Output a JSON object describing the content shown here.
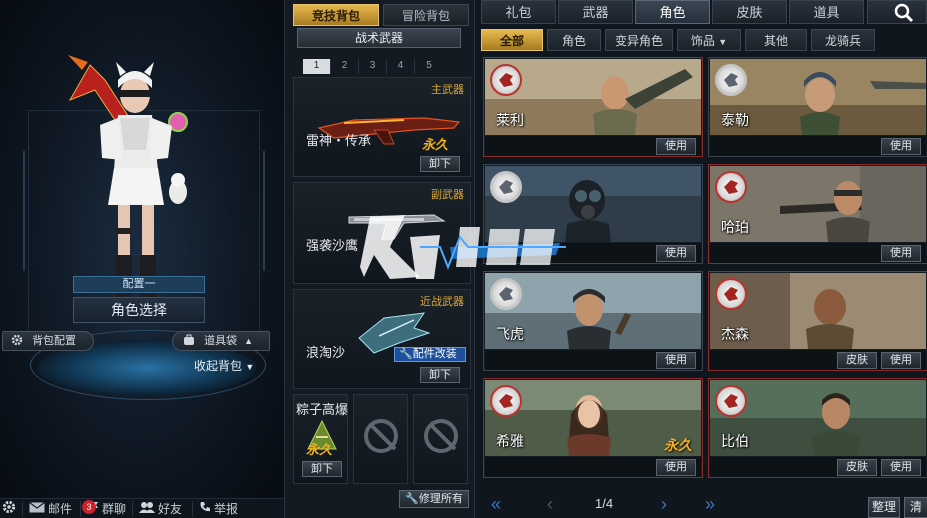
{
  "left": {
    "preset_label": "配置一",
    "char_select_label": "角色选择",
    "bag_config_label": "背包配置",
    "item_bag_label": "道具袋",
    "collapse_bag_label": "收起背包",
    "bottom_bar": {
      "mail_label": "邮件",
      "mail_count": "3",
      "group_chat_label": "群聊",
      "friends_label": "好友",
      "report_label": "举报"
    }
  },
  "middle": {
    "tabs": [
      {
        "label": "竞技背包",
        "active": true
      },
      {
        "label": "冒险背包",
        "active": false
      }
    ],
    "tactical_weapon_label": "战术武器",
    "slot_pages": [
      "1",
      "2",
      "3",
      "4",
      "5"
    ],
    "primary": {
      "category": "主武器",
      "name": "雷神・传承",
      "permanent": "永久",
      "unequip": "卸下"
    },
    "secondary": {
      "category": "副武器",
      "name": "强袭沙鹰"
    },
    "melee": {
      "category": "近战武器",
      "name": "浪淘沙",
      "mod_label": "配件改装",
      "unequip": "卸下"
    },
    "grenade": {
      "name": "粽子高爆",
      "permanent": "永久",
      "unequip": "卸下"
    },
    "repair_all_label": "修理所有"
  },
  "right": {
    "top_tabs": [
      {
        "label": "礼包",
        "active": false
      },
      {
        "label": "武器",
        "active": false
      },
      {
        "label": "角色",
        "active": true
      },
      {
        "label": "皮肤",
        "active": false
      },
      {
        "label": "道具",
        "active": false
      }
    ],
    "filters": [
      {
        "label": "全部",
        "active": true
      },
      {
        "label": "角色",
        "active": false
      },
      {
        "label": "变异角色",
        "active": false
      },
      {
        "label": "饰品",
        "active": false,
        "dropdown": true
      },
      {
        "label": "其他",
        "active": false
      },
      {
        "label": "龙骑兵",
        "active": false
      }
    ],
    "cards": [
      {
        "name": "莱利",
        "theme": "red",
        "buttons": [
          "使用"
        ]
      },
      {
        "name": "泰勒",
        "theme": "gray",
        "buttons": [
          "使用"
        ]
      },
      {
        "name": "",
        "theme": "gray",
        "buttons": [
          "使用"
        ]
      },
      {
        "name": "哈珀",
        "theme": "red",
        "buttons": [
          "使用"
        ]
      },
      {
        "name": "飞虎",
        "theme": "gray",
        "buttons": [
          "使用"
        ]
      },
      {
        "name": "杰森",
        "theme": "red",
        "buttons": [
          "皮肤",
          "使用"
        ]
      },
      {
        "name": "希雅",
        "theme": "red",
        "permanent": "永久",
        "buttons": [
          "使用"
        ]
      },
      {
        "name": "比伯",
        "theme": "red",
        "buttons": [
          "皮肤",
          "使用"
        ]
      }
    ],
    "pager": {
      "text": "1/4"
    },
    "sort_label": "整理",
    "clear_label": "清除"
  },
  "colors": {
    "gold_accent": "#e6b94d",
    "permanent_text": "#f0b21c",
    "red_card_border": "#8b2a2a",
    "blue_pager": "#3c76c9",
    "mail_badge": "#c8232b"
  }
}
